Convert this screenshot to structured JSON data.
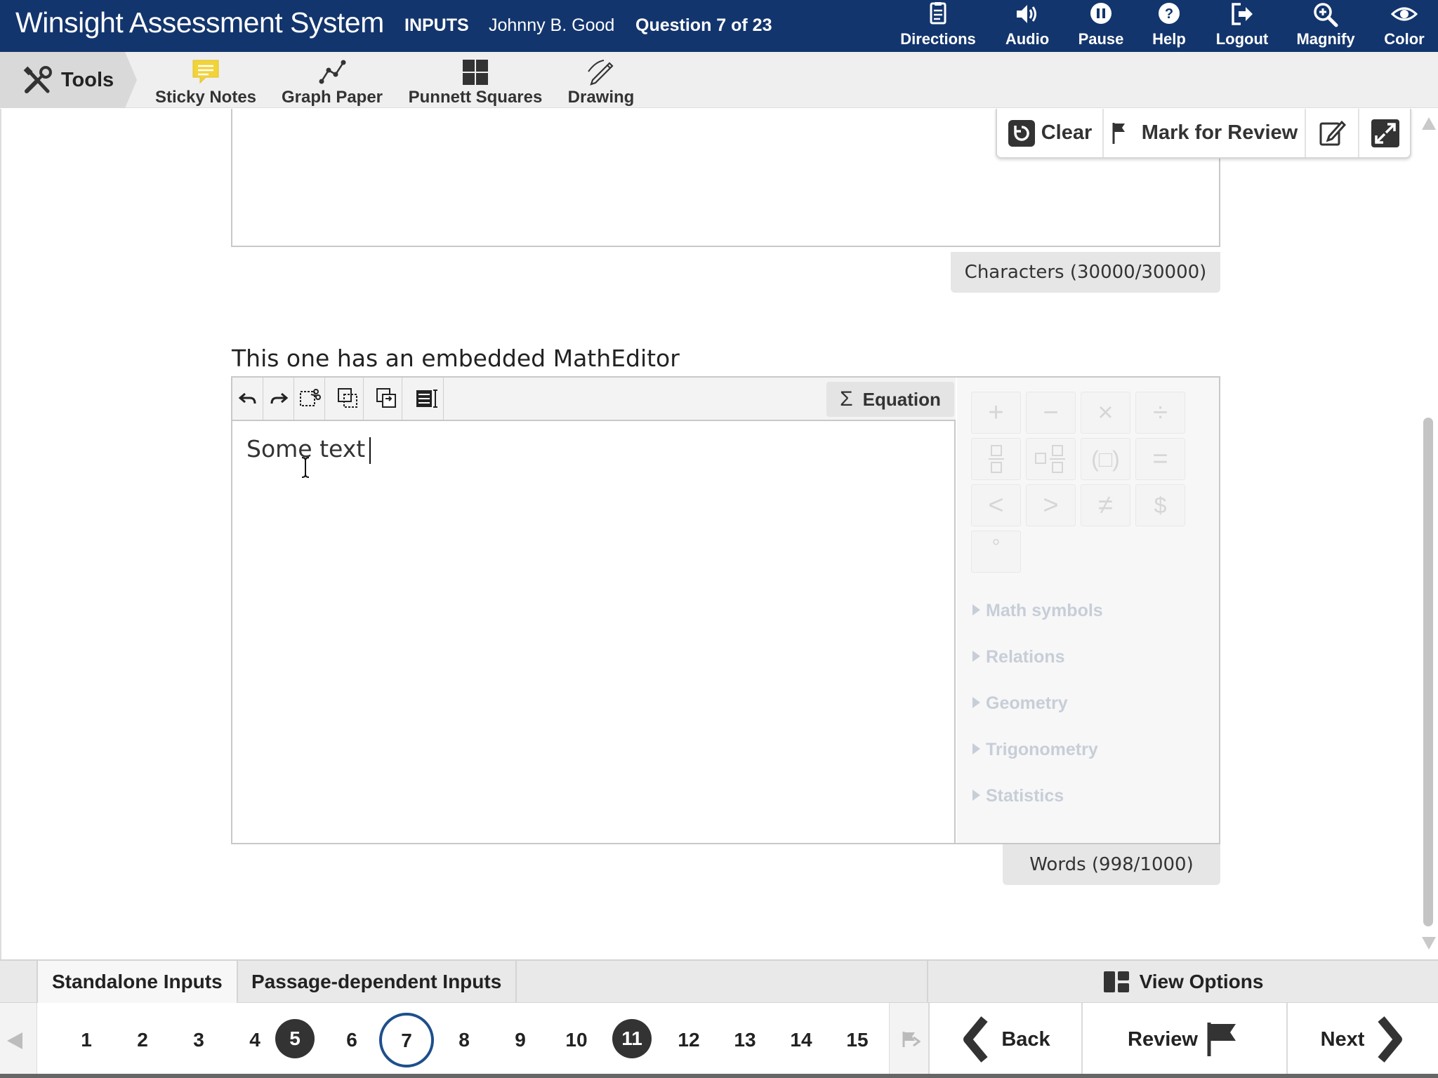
{
  "header": {
    "brand": "Winsight Assessment System",
    "section": "INPUTS",
    "user": "Johnny B. Good",
    "question_position": "Question 7 of 23",
    "nav": [
      {
        "label": "Directions",
        "icon": "directions-icon"
      },
      {
        "label": "Audio",
        "icon": "audio-icon"
      },
      {
        "label": "Pause",
        "icon": "pause-icon"
      },
      {
        "label": "Help",
        "icon": "help-icon"
      },
      {
        "label": "Logout",
        "icon": "logout-icon"
      },
      {
        "label": "Magnify",
        "icon": "magnify-icon"
      },
      {
        "label": "Color",
        "icon": "eye-icon"
      }
    ],
    "bg_color": "#13356d"
  },
  "toolbar": {
    "tools_label": "Tools",
    "items": [
      {
        "label": "Sticky Notes",
        "icon": "sticky-note-icon",
        "color": "#f2d338"
      },
      {
        "label": "Graph Paper",
        "icon": "graph-line-icon"
      },
      {
        "label": "Punnett Squares",
        "icon": "grid-icon"
      },
      {
        "label": "Drawing",
        "icon": "pencil-icon"
      }
    ]
  },
  "actions": {
    "clear": "Clear",
    "mark_review": "Mark for Review"
  },
  "first_response": {
    "counter": "Characters (30000/30000)"
  },
  "math_question": {
    "label": "This one has an embedded MathEditor",
    "equation_button": "Equation",
    "text": "Some text",
    "counter": "Words (998/1000)",
    "palette_keys": [
      "+",
      "−",
      "×",
      "÷",
      "frac",
      "mixed",
      "(□)",
      "=",
      "<",
      ">",
      "≠",
      "$",
      "°"
    ],
    "categories": [
      "Math symbols",
      "Relations",
      "Geometry",
      "Trigonometry",
      "Statistics"
    ]
  },
  "bottom": {
    "tabs": [
      "Standalone Inputs",
      "Passage-dependent Inputs"
    ],
    "view_options": "View Options",
    "questions": [
      "1",
      "2",
      "3",
      "4",
      "5",
      "6",
      "7",
      "8",
      "9",
      "10",
      "11",
      "12",
      "13",
      "14",
      "15"
    ],
    "answered": [
      "5",
      "11"
    ],
    "current": "7",
    "back": "Back",
    "review": "Review",
    "next": "Next"
  }
}
